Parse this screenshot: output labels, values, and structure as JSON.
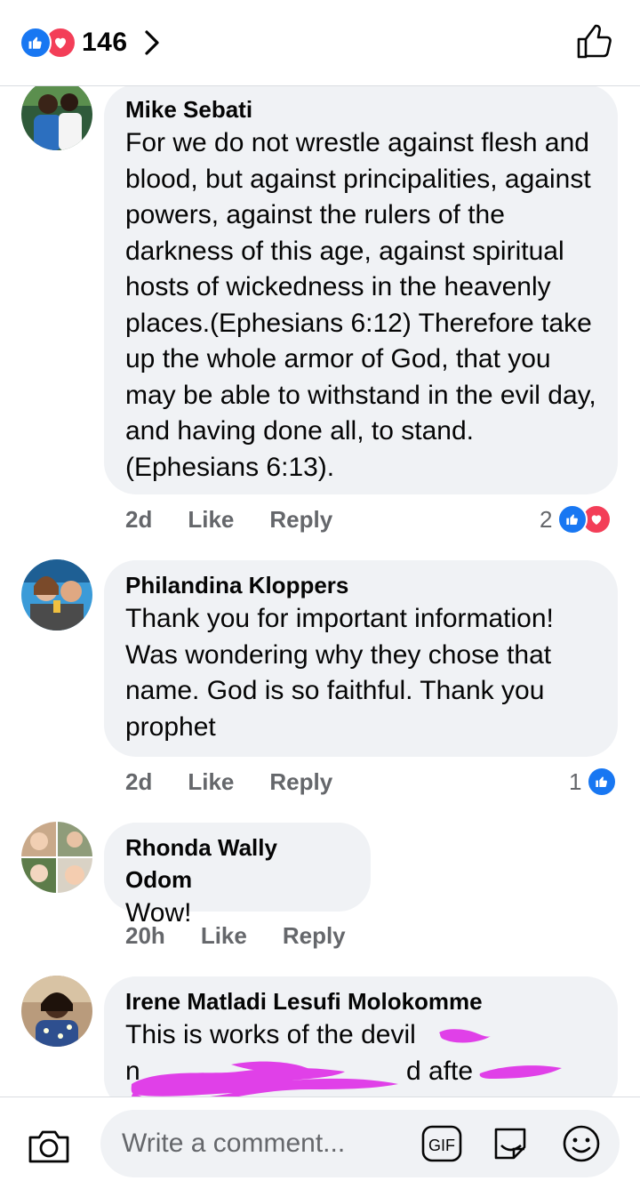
{
  "header": {
    "reaction_count": "146",
    "reaction_icons": [
      "like-icon",
      "love-icon"
    ],
    "chevron_icon": "chevron-right-icon",
    "like_icon": "thumbs-up-outline-icon"
  },
  "colors": {
    "like_blue": "#1877f2",
    "love_red": "#f33e58",
    "bubble_bg": "#f0f2f5",
    "meta_gray": "#65676b",
    "redaction_magenta": "#e040e8"
  },
  "comments": [
    {
      "author": "Mike Sebati",
      "text": "For we do not wrestle against flesh and blood, but against principalities, against powers, against the rulers of the darkness of this age, against spiritual hosts of wickedness in the heavenly places.(Ephesians 6:12) Therefore take up the whole armor of God, that you may be able to withstand in the evil day, and having done all, to stand.(Ephesians 6:13).",
      "time": "2d",
      "like_label": "Like",
      "reply_label": "Reply",
      "reaction_count": "2",
      "reactions": [
        "like-icon",
        "love-icon"
      ]
    },
    {
      "author": "Philandina Kloppers",
      "text": "Thank you for important information! Was wondering why they chose that name. God is so faithful.  Thank you prophet",
      "time": "2d",
      "like_label": "Like",
      "reply_label": "Reply",
      "reaction_count": "1",
      "reactions": [
        "like-icon"
      ]
    },
    {
      "author": "Rhonda Wally Odom",
      "text": "Wow!",
      "time": "20h",
      "like_label": "Like",
      "reply_label": "Reply"
    },
    {
      "author": "Irene Matladi Lesufi Molokomme",
      "line1": "This is works of the devil",
      "line2_start": "n",
      "line2_mid": "d afte",
      "redacted": true
    }
  ],
  "composer": {
    "placeholder": "Write a comment...",
    "camera_icon": "camera-icon",
    "gif_label": "GIF",
    "sticker_icon": "sticker-icon",
    "emoji_icon": "smiley-icon"
  }
}
